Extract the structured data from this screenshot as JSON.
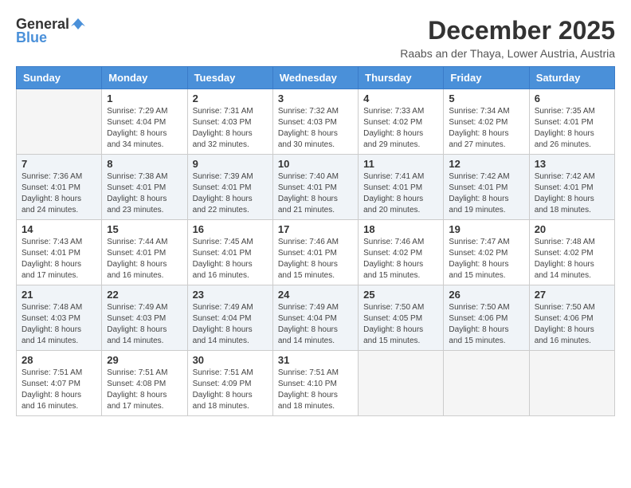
{
  "logo": {
    "general": "General",
    "blue": "Blue"
  },
  "title": {
    "month": "December 2025",
    "location": "Raabs an der Thaya, Lower Austria, Austria"
  },
  "days_header": [
    "Sunday",
    "Monday",
    "Tuesday",
    "Wednesday",
    "Thursday",
    "Friday",
    "Saturday"
  ],
  "weeks": [
    [
      {
        "day": "",
        "info": ""
      },
      {
        "day": "1",
        "info": "Sunrise: 7:29 AM\nSunset: 4:04 PM\nDaylight: 8 hours\nand 34 minutes."
      },
      {
        "day": "2",
        "info": "Sunrise: 7:31 AM\nSunset: 4:03 PM\nDaylight: 8 hours\nand 32 minutes."
      },
      {
        "day": "3",
        "info": "Sunrise: 7:32 AM\nSunset: 4:03 PM\nDaylight: 8 hours\nand 30 minutes."
      },
      {
        "day": "4",
        "info": "Sunrise: 7:33 AM\nSunset: 4:02 PM\nDaylight: 8 hours\nand 29 minutes."
      },
      {
        "day": "5",
        "info": "Sunrise: 7:34 AM\nSunset: 4:02 PM\nDaylight: 8 hours\nand 27 minutes."
      },
      {
        "day": "6",
        "info": "Sunrise: 7:35 AM\nSunset: 4:01 PM\nDaylight: 8 hours\nand 26 minutes."
      }
    ],
    [
      {
        "day": "7",
        "info": "Sunrise: 7:36 AM\nSunset: 4:01 PM\nDaylight: 8 hours\nand 24 minutes."
      },
      {
        "day": "8",
        "info": "Sunrise: 7:38 AM\nSunset: 4:01 PM\nDaylight: 8 hours\nand 23 minutes."
      },
      {
        "day": "9",
        "info": "Sunrise: 7:39 AM\nSunset: 4:01 PM\nDaylight: 8 hours\nand 22 minutes."
      },
      {
        "day": "10",
        "info": "Sunrise: 7:40 AM\nSunset: 4:01 PM\nDaylight: 8 hours\nand 21 minutes."
      },
      {
        "day": "11",
        "info": "Sunrise: 7:41 AM\nSunset: 4:01 PM\nDaylight: 8 hours\nand 20 minutes."
      },
      {
        "day": "12",
        "info": "Sunrise: 7:42 AM\nSunset: 4:01 PM\nDaylight: 8 hours\nand 19 minutes."
      },
      {
        "day": "13",
        "info": "Sunrise: 7:42 AM\nSunset: 4:01 PM\nDaylight: 8 hours\nand 18 minutes."
      }
    ],
    [
      {
        "day": "14",
        "info": "Sunrise: 7:43 AM\nSunset: 4:01 PM\nDaylight: 8 hours\nand 17 minutes."
      },
      {
        "day": "15",
        "info": "Sunrise: 7:44 AM\nSunset: 4:01 PM\nDaylight: 8 hours\nand 16 minutes."
      },
      {
        "day": "16",
        "info": "Sunrise: 7:45 AM\nSunset: 4:01 PM\nDaylight: 8 hours\nand 16 minutes."
      },
      {
        "day": "17",
        "info": "Sunrise: 7:46 AM\nSunset: 4:01 PM\nDaylight: 8 hours\nand 15 minutes."
      },
      {
        "day": "18",
        "info": "Sunrise: 7:46 AM\nSunset: 4:02 PM\nDaylight: 8 hours\nand 15 minutes."
      },
      {
        "day": "19",
        "info": "Sunrise: 7:47 AM\nSunset: 4:02 PM\nDaylight: 8 hours\nand 15 minutes."
      },
      {
        "day": "20",
        "info": "Sunrise: 7:48 AM\nSunset: 4:02 PM\nDaylight: 8 hours\nand 14 minutes."
      }
    ],
    [
      {
        "day": "21",
        "info": "Sunrise: 7:48 AM\nSunset: 4:03 PM\nDaylight: 8 hours\nand 14 minutes."
      },
      {
        "day": "22",
        "info": "Sunrise: 7:49 AM\nSunset: 4:03 PM\nDaylight: 8 hours\nand 14 minutes."
      },
      {
        "day": "23",
        "info": "Sunrise: 7:49 AM\nSunset: 4:04 PM\nDaylight: 8 hours\nand 14 minutes."
      },
      {
        "day": "24",
        "info": "Sunrise: 7:49 AM\nSunset: 4:04 PM\nDaylight: 8 hours\nand 14 minutes."
      },
      {
        "day": "25",
        "info": "Sunrise: 7:50 AM\nSunset: 4:05 PM\nDaylight: 8 hours\nand 15 minutes."
      },
      {
        "day": "26",
        "info": "Sunrise: 7:50 AM\nSunset: 4:06 PM\nDaylight: 8 hours\nand 15 minutes."
      },
      {
        "day": "27",
        "info": "Sunrise: 7:50 AM\nSunset: 4:06 PM\nDaylight: 8 hours\nand 16 minutes."
      }
    ],
    [
      {
        "day": "28",
        "info": "Sunrise: 7:51 AM\nSunset: 4:07 PM\nDaylight: 8 hours\nand 16 minutes."
      },
      {
        "day": "29",
        "info": "Sunrise: 7:51 AM\nSunset: 4:08 PM\nDaylight: 8 hours\nand 17 minutes."
      },
      {
        "day": "30",
        "info": "Sunrise: 7:51 AM\nSunset: 4:09 PM\nDaylight: 8 hours\nand 18 minutes."
      },
      {
        "day": "31",
        "info": "Sunrise: 7:51 AM\nSunset: 4:10 PM\nDaylight: 8 hours\nand 18 minutes."
      },
      {
        "day": "",
        "info": ""
      },
      {
        "day": "",
        "info": ""
      },
      {
        "day": "",
        "info": ""
      }
    ]
  ]
}
